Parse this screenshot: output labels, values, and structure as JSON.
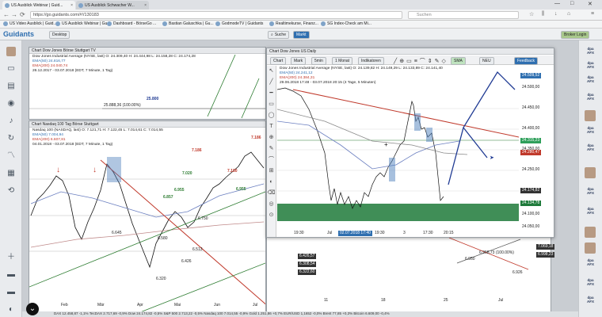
{
  "browser": {
    "tabs": [
      {
        "label": "US Ausblick Webinar | Guid..."
      },
      {
        "label": "US Ausblick Schwacher W..."
      },
      {
        "label": "US Video Ausblick | Guid..."
      },
      {
        "label": "Dashboard - BörseGo ..."
      },
      {
        "label": "Bastian Galuschka | Gu..."
      },
      {
        "label": "GodmodeTV | Guidants"
      },
      {
        "label": "Realtimekurse, Finanz..."
      },
      {
        "label": "SG Index-Check am Mi..."
      }
    ],
    "url": "https://go.guidants.com/#!/130183",
    "search_placeholder": "Suchen",
    "bookmarks": [
      "US Video Ausblick | Guid...",
      "US Ausblick Webinar | Gu...",
      "Dashboard - BörseGo ...",
      "Bastian Galuschka | Gu...",
      "GodmodeTV | Guidants",
      "Realtimekurse, Finanz...",
      "SG Index-Check am Mi..."
    ]
  },
  "app": {
    "logo": "Guidants",
    "desktop_label": "Desktop",
    "search_label": "Suche",
    "markt_label": "Markt",
    "broker_label": "Broker Login"
  },
  "panel_top_left": {
    "title": "Chart Dow Jones Börse Stuttgart TV",
    "legend": [
      "Dow Jones Industrial Average (NYSE, last)  O: 24.309,40  H: 24.444,98  L: 24.158,28  C: 24.174,28",
      "EMA(50)  24.816,77",
      "EMA(200)  24.040,74",
      "26.12.2017 - 03.07.2018  (EDT, 7 Minute, 1 Tag)"
    ],
    "labels": [
      "25.800",
      "25.888,36 (100.00%)"
    ]
  },
  "panel_left": {
    "title": "Chart Nasdaq 100 Tag Börse Stuttgart",
    "legend": [
      "Nasdaq 100 (NASDAQ, last)  O: 7.121,71  H: 7.122,45  L: 7.014,61  C: 7.014,55",
      "EMA(50)  7.004,94",
      "EMA(200)  6.607,81",
      "04.01.2018 - 03.07.2018  (EDT, 7 Minute, 1 Tag)"
    ],
    "levels": [
      "7.186",
      "7.186",
      "7.020",
      "7.180",
      "6.857",
      "6.955",
      "6.955",
      "6.750",
      "6.645",
      "6.580",
      "6.513",
      "6.426",
      "6.320"
    ],
    "x_labels": [
      "Feb",
      "Mär",
      "Apr",
      "Mai",
      "Jun",
      "Jul"
    ]
  },
  "panel_main": {
    "title": "Chart Dow Jones US Daily",
    "toolbar": [
      "Chart",
      "Mark",
      "5min",
      "1 Monat",
      "Indikatoren",
      "SMA",
      "NEU",
      "Feedback"
    ],
    "legend": [
      "Dow Jones Industrial Average (NYSE, last)  O: 24.139,82  H: 24.149,29  L: 24.133,89  C: 24.141,40",
      "EMA(50)  24.241,12",
      "EMA(200)  24.384,31",
      "29.06.2018 17:48 - 03.07.2018 20:15  (4 Tage, 5 Minuten)"
    ],
    "price_labels": [
      "24.509,52",
      "24.500,00",
      "24.450,00",
      "24.400,00",
      "24.350,00",
      "24.315,23",
      "24.280,47",
      "24.250,00",
      "24.200,00",
      "24.174,82",
      "24.150,00",
      "24.134,78",
      "24.100,00",
      "24.050,00"
    ],
    "x_labels": [
      "19:30",
      "Jul",
      "02.07.2018 17:40",
      "19:30",
      "3",
      "17:30",
      "20:15"
    ],
    "ylabel_tag": "24.509,52"
  },
  "panel_right_axis": {
    "prices": [
      "7.069,18",
      "6.998,23",
      "6.976,07",
      "6.426,57",
      "6.322,60",
      "6.308,54",
      "7.014,55"
    ],
    "labels": [
      "6.950",
      "6.926",
      "6.958,73 (100.00%)"
    ],
    "x_labels": [
      "11",
      "18",
      "25",
      "Jul"
    ]
  },
  "status": "DAX 12.458,87 -1,1%   TecDAX 2.717,69 -0,9%   Dow 24.174,82 -0,5%   S&P 500 2.713,22 -0,5%   Nasdaq 100 7.014,55 -0,9%   Gold 1.251,86 +0,7%   EUR/USD 1,1652 -0,0%   Brent 77,85 +0,3%   Bitcoin 6.609,00 -0,4%",
  "colors": {
    "accent": "#2f6fb0",
    "resistance": "#c0392b",
    "support": "#2e7d32",
    "forecast": "#1f3a93",
    "zone": "#1e7a3a"
  },
  "icons": {
    "left": [
      "user-icon",
      "monitor-icon",
      "clipboard-icon",
      "eye-icon",
      "bell-icon",
      "chart-icon",
      "grid-icon",
      "refresh-icon",
      "plus-icon",
      "folder-icon",
      "folder-icon"
    ]
  }
}
